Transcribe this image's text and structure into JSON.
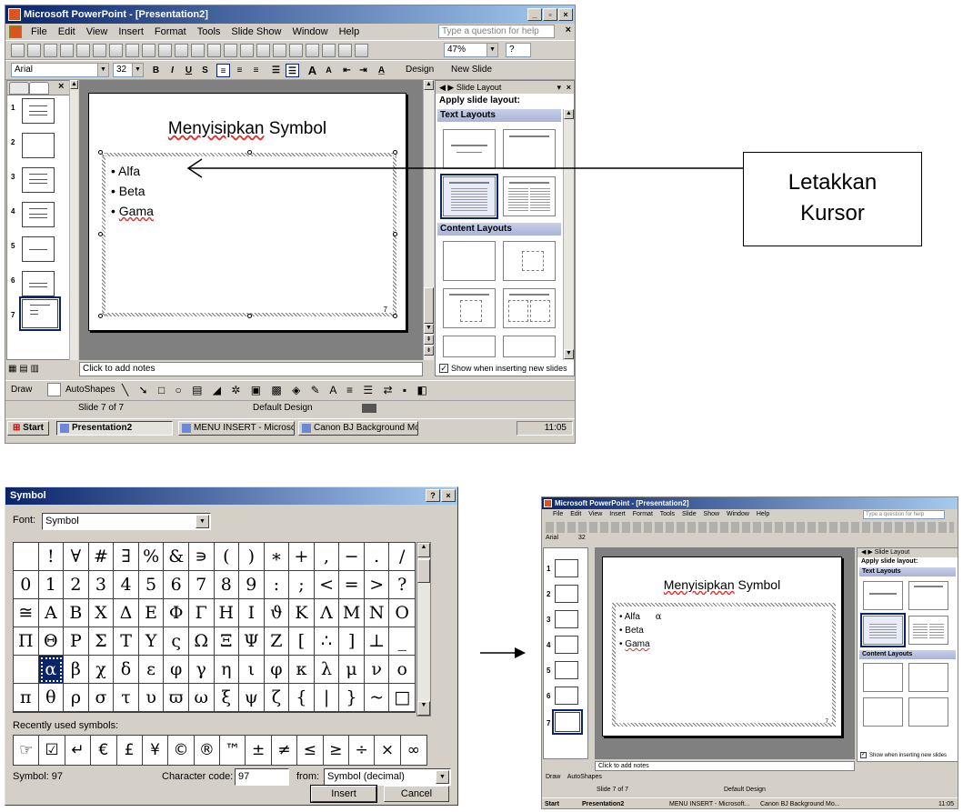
{
  "ppt": {
    "window_title": "Microsoft PowerPoint - [Presentation2]",
    "win_min": "_",
    "win_max": "▫",
    "win_close": "×",
    "menu": [
      "File",
      "Edit",
      "View",
      "Insert",
      "Format",
      "Tools",
      "Slide Show",
      "Window",
      "Help"
    ],
    "help_placeholder": "Type a question for help",
    "zoom": "47%",
    "font_name": "Arial",
    "font_size": "32",
    "design_label": "Design",
    "new_slide_label": "New Slide",
    "thumbnail_numbers": [
      "1",
      "2",
      "3",
      "4",
      "5",
      "6",
      "7"
    ],
    "slide_title": "Menyisipkan Symbol",
    "slide_title_word1": "Menyisipkan",
    "slide_title_word2": "Symbol",
    "bullets": [
      "Alfa",
      "Beta",
      "Gama"
    ],
    "inserted_symbol": "α",
    "slide_number_mark": "7",
    "taskpane_title": "Slide Layout",
    "apply_label": "Apply slide layout:",
    "text_layouts_label": "Text Layouts",
    "content_layouts_label": "Content Layouts",
    "show_when_inserting": "Show when inserting new slides",
    "notes_placeholder": "Click to add notes",
    "draw_label": "Draw",
    "autoshapes_label": "AutoShapes",
    "status_slide": "Slide 7 of 7",
    "status_design": "Default Design",
    "start_label": "Start",
    "taskbar_items": [
      "Presentation2",
      "MENU INSERT - Microsoft...",
      "Canon BJ Background Mo..."
    ],
    "clock": "11:05"
  },
  "callout": {
    "line1": "Letakkan",
    "line2": "Kursor"
  },
  "symbol_dialog": {
    "title": "Symbol",
    "help_btn": "?",
    "close_btn": "×",
    "font_label": "Font:",
    "font_value": "Symbol",
    "grid": [
      " ",
      "!",
      "∀",
      "#",
      "∃",
      "%",
      "&",
      "∍",
      "(",
      ")",
      "∗",
      "+",
      ",",
      "−",
      ".",
      "/",
      "0",
      "1",
      "2",
      "3",
      "4",
      "5",
      "6",
      "7",
      "8",
      "9",
      ":",
      ";",
      "<",
      "=",
      ">",
      "?",
      "≅",
      "Α",
      "Β",
      "Χ",
      "Δ",
      "Ε",
      "Φ",
      "Γ",
      "Η",
      "Ι",
      "ϑ",
      "Κ",
      "Λ",
      "Μ",
      "Ν",
      "Ο",
      "Π",
      "Θ",
      "Ρ",
      "Σ",
      "Τ",
      "Υ",
      "ς",
      "Ω",
      "Ξ",
      "Ψ",
      "Ζ",
      "[",
      "∴",
      "]",
      "⊥",
      "_",
      " ",
      "α",
      "β",
      "χ",
      "δ",
      "ε",
      "φ",
      "γ",
      "η",
      "ι",
      "φ",
      "κ",
      "λ",
      "μ",
      "ν",
      "ο",
      "π",
      "θ",
      "ρ",
      "σ",
      "τ",
      "υ",
      "ϖ",
      "ω",
      "ξ",
      "ψ",
      "ζ",
      "{",
      "|",
      "}",
      "~",
      "□"
    ],
    "selected_index": 65,
    "recent_label": "Recently used symbols:",
    "recent": [
      "☞",
      "☑",
      "↵",
      "€",
      "£",
      "¥",
      "©",
      "®",
      "™",
      "±",
      "≠",
      "≤",
      "≥",
      "÷",
      "×",
      "∞"
    ],
    "symbol_info": "Symbol: 97",
    "char_code_label": "Character code:",
    "char_code_value": "97",
    "from_label": "from:",
    "from_value": "Symbol (decimal)",
    "insert_label": "Insert",
    "cancel_label": "Cancel"
  }
}
